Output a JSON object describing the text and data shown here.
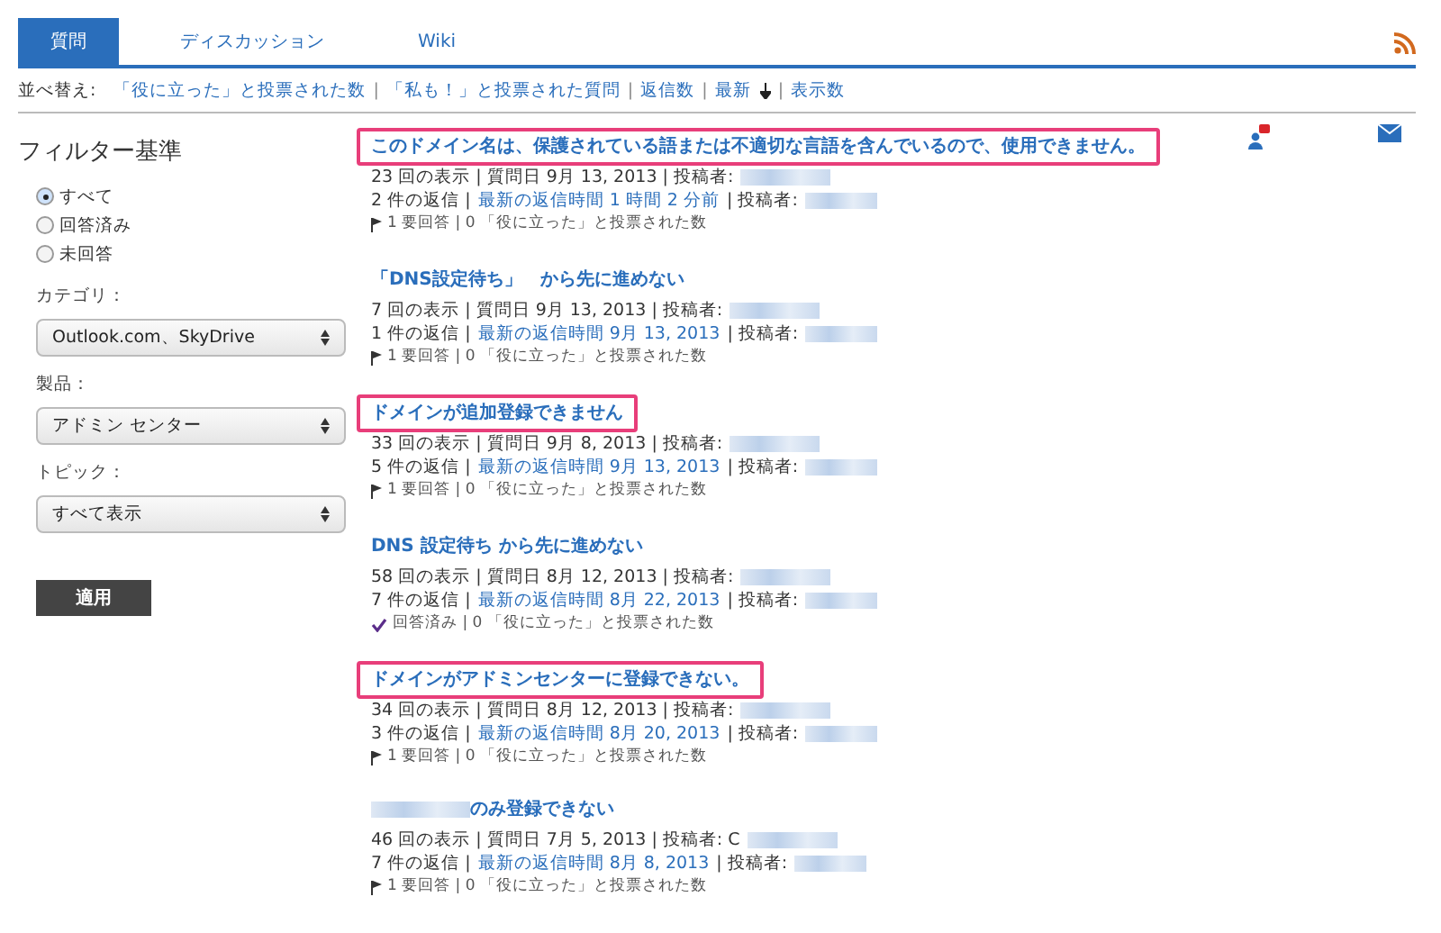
{
  "tabs": [
    {
      "label": "質問",
      "selected": true
    },
    {
      "label": "ディスカッション",
      "selected": false
    },
    {
      "label": "Wiki",
      "selected": false
    }
  ],
  "sort_bar": {
    "label": "並べ替え:",
    "separator": "|",
    "options": [
      {
        "label": "「役に立った」と投票された数",
        "selected": false
      },
      {
        "label": "「私も！」と投票された質問",
        "selected": false
      },
      {
        "label": "返信数",
        "selected": false
      },
      {
        "label": "最新",
        "selected": true
      },
      {
        "label": "表示数",
        "selected": false
      }
    ]
  },
  "filter": {
    "title": "フィルター基準",
    "radios": [
      {
        "label": "すべて",
        "selected": true
      },
      {
        "label": "回答済み",
        "selected": false
      },
      {
        "label": "未回答",
        "selected": false
      }
    ],
    "selects": [
      {
        "label": "カテゴリ：",
        "value": "Outlook.com、SkyDrive"
      },
      {
        "label": "製品：",
        "value": "アドミン センター"
      },
      {
        "label": "トピック：",
        "value": "すべて表示"
      }
    ],
    "apply_button": "適用"
  },
  "questions": [
    {
      "title": "このドメイン名は、保護されている語または不適切な言語を含んでいるので、使用できません。",
      "highlighted": true,
      "meta": "23 回の表示 | 質問日 9月 13, 2013 | 投稿者:",
      "replies": "2 件の返信 |",
      "latest": "最新の返信時間 1 時間 2 分前",
      "reply_author_label": "| 投稿者:",
      "status": {
        "kind": "unanswered",
        "label": "1 要回答 | 0 「役に立った」と投票された数"
      }
    },
    {
      "title": "「DNS設定待ち」　から先に進めない",
      "highlighted": false,
      "meta": "7 回の表示 | 質問日 9月 13, 2013 | 投稿者:",
      "replies": "1 件の返信 |",
      "latest": "最新の返信時間 9月 13, 2013",
      "reply_author_label": "| 投稿者:",
      "status": {
        "kind": "unanswered",
        "label": "1 要回答 | 0 「役に立った」と投票された数"
      }
    },
    {
      "title": "ドメインが追加登録できません",
      "highlighted": true,
      "meta": "33 回の表示 | 質問日 9月 8, 2013 | 投稿者:",
      "replies": "5 件の返信 |",
      "latest": "最新の返信時間 9月 13, 2013",
      "reply_author_label": "| 投稿者:",
      "status": {
        "kind": "unanswered",
        "label": "1 要回答 | 0 「役に立った」と投票された数"
      }
    },
    {
      "title": "DNS 設定待ち から先に進めない",
      "highlighted": false,
      "meta": "58 回の表示 | 質問日 8月 12, 2013 | 投稿者:",
      "replies": "7 件の返信 |",
      "latest": "最新の返信時間 8月 22, 2013",
      "reply_author_label": "| 投稿者:",
      "status": {
        "kind": "answered",
        "label": "回答済み | 0 「役に立った」と投票された数"
      }
    },
    {
      "title": "ドメインがアドミンセンターに登録できない。",
      "highlighted": true,
      "meta": "34 回の表示 | 質問日 8月 12, 2013 | 投稿者:",
      "replies": "3 件の返信 |",
      "latest": "最新の返信時間 8月 20, 2013",
      "reply_author_label": "| 投稿者:",
      "status": {
        "kind": "unanswered",
        "label": "1 要回答 | 0 「役に立った」と投票された数"
      }
    },
    {
      "title": "のみ登録できない",
      "title_prefix_hidden": true,
      "highlighted": false,
      "meta": "46 回の表示 | 質問日 7月 5, 2013 | 投稿者: C",
      "replies": "7 件の返信 |",
      "latest": "最新の返信時間 8月 8, 2013",
      "reply_author_label": "| 投稿者:",
      "status": {
        "kind": "unanswered",
        "label": "1 要回答 | 0 「役に立った」と投票された数"
      }
    }
  ]
}
